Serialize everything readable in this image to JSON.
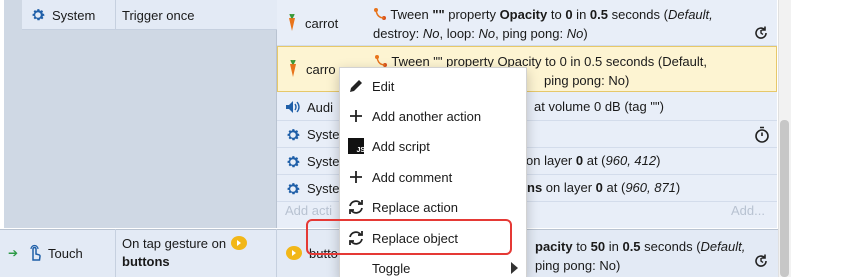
{
  "event1": {
    "condition": {
      "object": "System",
      "text": "Trigger once"
    },
    "actions": [
      {
        "object": "carrot",
        "parts": [
          "Tween \"\" property ",
          "Opacity",
          " to ",
          "0",
          " in ",
          "0.5",
          " seconds (",
          "Default,",
          "",
          "destroy: ",
          "No",
          ", loop: ",
          "No",
          ", ping pong: ",
          "No",
          ")"
        ]
      },
      {
        "object": "carrot",
        "line1": "Tween \"\" property Opacity to 0 in 0.5 seconds (Default,",
        "line2": "ping pong: No)",
        "obj_label": "carro"
      },
      {
        "object": "Audio",
        "obj_label": "Audi",
        "text": "at volume 0 dB (tag \"\")"
      },
      {
        "object": "System",
        "obj_label": "Syste",
        "text": ""
      },
      {
        "object": "System",
        "obj_label": "Syste",
        "text_a": "on layer ",
        "text_b": "0",
        "text_c": " at (",
        "text_d": "960, 412",
        "text_e": ")"
      },
      {
        "object": "System",
        "obj_label": "Syste",
        "text_a": "on layer ",
        "text_b": "0",
        "text_c": " at (",
        "text_d": "960, 871",
        "text_e": ")",
        "text_pre": "ns"
      }
    ],
    "add_action": "Add acti",
    "add_more": "Add..."
  },
  "event2": {
    "condition": {
      "object": "Touch",
      "text_prefix": "On tap gesture on",
      "text_bold": "buttons"
    },
    "action": {
      "object": "butto",
      "line1_a": "pacity",
      "line1_b": " to ",
      "line1_c": "50",
      "line1_d": " in ",
      "line1_e": "0.5",
      "line1_f": " seconds (",
      "line1_g": "Default,",
      "line2": "ping pong: No)"
    }
  },
  "tween_parts": {
    "t_pre": "Tween ",
    "t_q": "\"\"",
    "t_prop": " property ",
    "t_op": "Opacity",
    "t_to": " to ",
    "t_zero": "0",
    "t_in": " in ",
    "t_half": "0.5",
    "t_sec": " seconds (",
    "t_def": "Default,",
    "line2_a": "destroy: ",
    "line2_b": "No",
    "line2_c": ", loop: ",
    "line2_d": "No",
    "line2_e": ", ping pong: ",
    "line2_f": "No",
    "line2_g": ")"
  },
  "context_menu": {
    "items": [
      {
        "label": "Edit",
        "icon": "pencil-icon"
      },
      {
        "label": "Add another action",
        "icon": "plus-icon"
      },
      {
        "label": "Add script",
        "icon": "js-icon"
      },
      {
        "label": "Add comment",
        "icon": "plus-icon"
      },
      {
        "label": "Replace action",
        "icon": "replace-icon"
      },
      {
        "label": "Replace object",
        "icon": "replace-icon"
      },
      {
        "label": "Toggle",
        "icon": "none"
      }
    ]
  },
  "colors": {
    "highlight_border": "#e53935",
    "accent_blue": "#1f5fa8",
    "touch_green": "#2d9b46"
  }
}
